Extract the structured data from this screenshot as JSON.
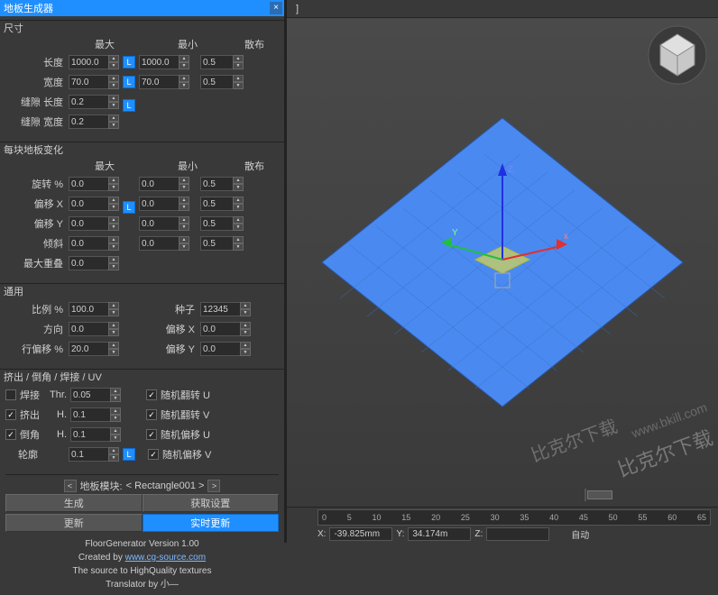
{
  "window": {
    "title": "地板生成器",
    "close": "×"
  },
  "sections": {
    "size": {
      "title": "尺寸",
      "cols": {
        "max": "最大",
        "min": "最小",
        "spread": "散布"
      },
      "rows": {
        "length": {
          "label": "长度",
          "max": "1000.0",
          "min": "1000.0",
          "spread": "0.5"
        },
        "width": {
          "label": "宽度",
          "max": "70.0",
          "min": "70.0",
          "spread": "0.5"
        },
        "gapLen": {
          "label": "缝隙 长度",
          "val": "0.2"
        },
        "gapWid": {
          "label": "缝隙 宽度",
          "val": "0.2"
        }
      },
      "lock": "L"
    },
    "variation": {
      "title": "每块地板变化",
      "cols": {
        "max": "最大",
        "min": "最小",
        "spread": "散布"
      },
      "rows": {
        "rotate": {
          "label": "旋转 %",
          "max": "0.0",
          "min": "0.0",
          "spread": "0.5"
        },
        "offX": {
          "label": "偏移 X",
          "max": "0.0",
          "min": "0.0",
          "spread": "0.5"
        },
        "offY": {
          "label": "偏移 Y",
          "max": "0.0",
          "min": "0.0",
          "spread": "0.5"
        },
        "tilt": {
          "label": "倾斜",
          "max": "0.0",
          "min": "0.0",
          "spread": "0.5"
        },
        "overlap": {
          "label": "最大重叠",
          "val": "0.0"
        }
      },
      "lock": "L"
    },
    "general": {
      "title": "通用",
      "rows": {
        "scale": {
          "label": "比例 %",
          "val": "100.0"
        },
        "dir": {
          "label": "方向",
          "val": "0.0"
        },
        "rowOff": {
          "label": "行偏移 %",
          "val": "20.0"
        },
        "seed": {
          "label": "种子",
          "val": "12345"
        },
        "offX": {
          "label": "偏移 X",
          "val": "0.0"
        },
        "offY": {
          "label": "偏移 Y",
          "val": "0.0"
        }
      }
    },
    "extrude": {
      "title": "挤出 / 倒角 / 焊接 / UV",
      "weld": {
        "label": "焊接",
        "thr": "Thr.",
        "val": "0.05"
      },
      "extrude": {
        "label": "挤出",
        "h": "H.",
        "val": "0.1"
      },
      "chamfer": {
        "label": "倒角",
        "h": "H.",
        "val": "0.1"
      },
      "outline": {
        "label": "轮廓",
        "val": "0.1"
      },
      "lock": "L",
      "uv": {
        "flipU": "随机翻转 U",
        "flipV": "随机翻转 V",
        "offU": "随机偏移 U",
        "offV": "随机偏移 V"
      }
    },
    "module": {
      "label": "地板模块:",
      "value": "< Rectangle001 >"
    },
    "buttons": {
      "generate": "生成",
      "getSettings": "获取设置",
      "update": "更新",
      "realtime": "实时更新"
    }
  },
  "footer": {
    "l1": "FloorGenerator Version 1.00",
    "l2": "Created by ",
    "link": "www.cg-source.com",
    "l3": "The source to HighQuality textures",
    "l4": "Translator by 小—"
  },
  "viewport": {
    "topLabel": "]",
    "axes": {
      "x": "x",
      "y": "Y",
      "z": "Z"
    },
    "timeline": {
      "marks": [
        "0",
        "5",
        "10",
        "15",
        "20",
        "25",
        "30",
        "35",
        "40",
        "45",
        "50",
        "55",
        "60",
        "65"
      ]
    },
    "status": {
      "xlabel": "X:",
      "xval": "-39.825mm",
      "ylabel": "Y:",
      "yval": "34.174m",
      "zlabel": "Z:",
      "auto": "自动"
    }
  },
  "watermark": {
    "text1": "比克尔下载",
    "text2": "www.bkill.com",
    "text3": "比克尔下载"
  }
}
